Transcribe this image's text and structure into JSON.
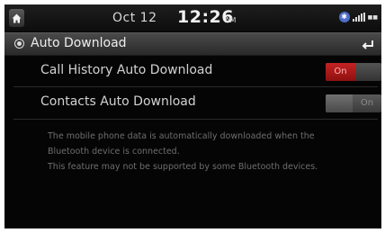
{
  "statusbar": {
    "date": "Oct 12",
    "time": "12:26",
    "ampm": "AM",
    "icons": [
      "bluetooth-phone-icon",
      "signal-icon",
      "network-icon"
    ]
  },
  "header": {
    "title": "Auto Download",
    "back_icon": "back-arrow-icon"
  },
  "settings": [
    {
      "label": "Call History Auto Download",
      "toggle_text": "On",
      "state": "on"
    },
    {
      "label": "Contacts Auto Download",
      "toggle_text": "On",
      "state": "off"
    }
  ],
  "description": {
    "line1": "The mobile phone data is automatically downloaded when the",
    "line2": "Bluetooth device is connected.",
    "line3": "This feature may not be supported by some Bluetooth devices."
  },
  "colors": {
    "toggle_on": "#c42323",
    "background": "#050505",
    "bluetooth": "#4d6ec9"
  }
}
